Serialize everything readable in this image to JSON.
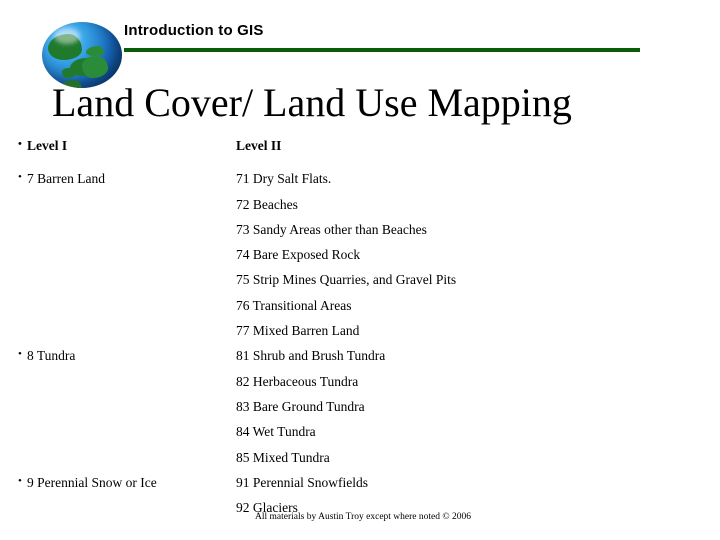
{
  "header": {
    "course_title": "Introduction to GIS",
    "logo_name": "globe-logo",
    "rule_color": "#0a5c0a"
  },
  "slide": {
    "title": "Land Cover/ Land Use Mapping"
  },
  "table": {
    "headers": {
      "left": "Level I",
      "right": "Level II"
    },
    "rows": [
      {
        "left": "7 Barren Land",
        "right": "71 Dry Salt Flats."
      },
      {
        "left": "",
        "right": "72 Beaches"
      },
      {
        "left": "",
        "right": "73 Sandy Areas other than Beaches"
      },
      {
        "left": "",
        "right": "74 Bare Exposed Rock"
      },
      {
        "left": "",
        "right": "75 Strip Mines Quarries, and Gravel Pits"
      },
      {
        "left": "",
        "right": "76 Transitional Areas"
      },
      {
        "left": "",
        "right": "77 Mixed Barren Land"
      },
      {
        "left": "8 Tundra",
        "right": "81 Shrub and Brush Tundra"
      },
      {
        "left": "",
        "right": "82 Herbaceous Tundra"
      },
      {
        "left": "",
        "right": "83 Bare Ground Tundra"
      },
      {
        "left": "",
        "right": "84 Wet Tundra"
      },
      {
        "left": "",
        "right": "85 Mixed Tundra"
      },
      {
        "left": "9 Perennial Snow or Ice",
        "right": "91 Perennial Snowfields"
      },
      {
        "left": "",
        "right": "92 Glaciers"
      }
    ],
    "bullet_glyph": "•"
  },
  "footer": {
    "credit": "All materials by Austin Troy except where noted © 2006"
  }
}
